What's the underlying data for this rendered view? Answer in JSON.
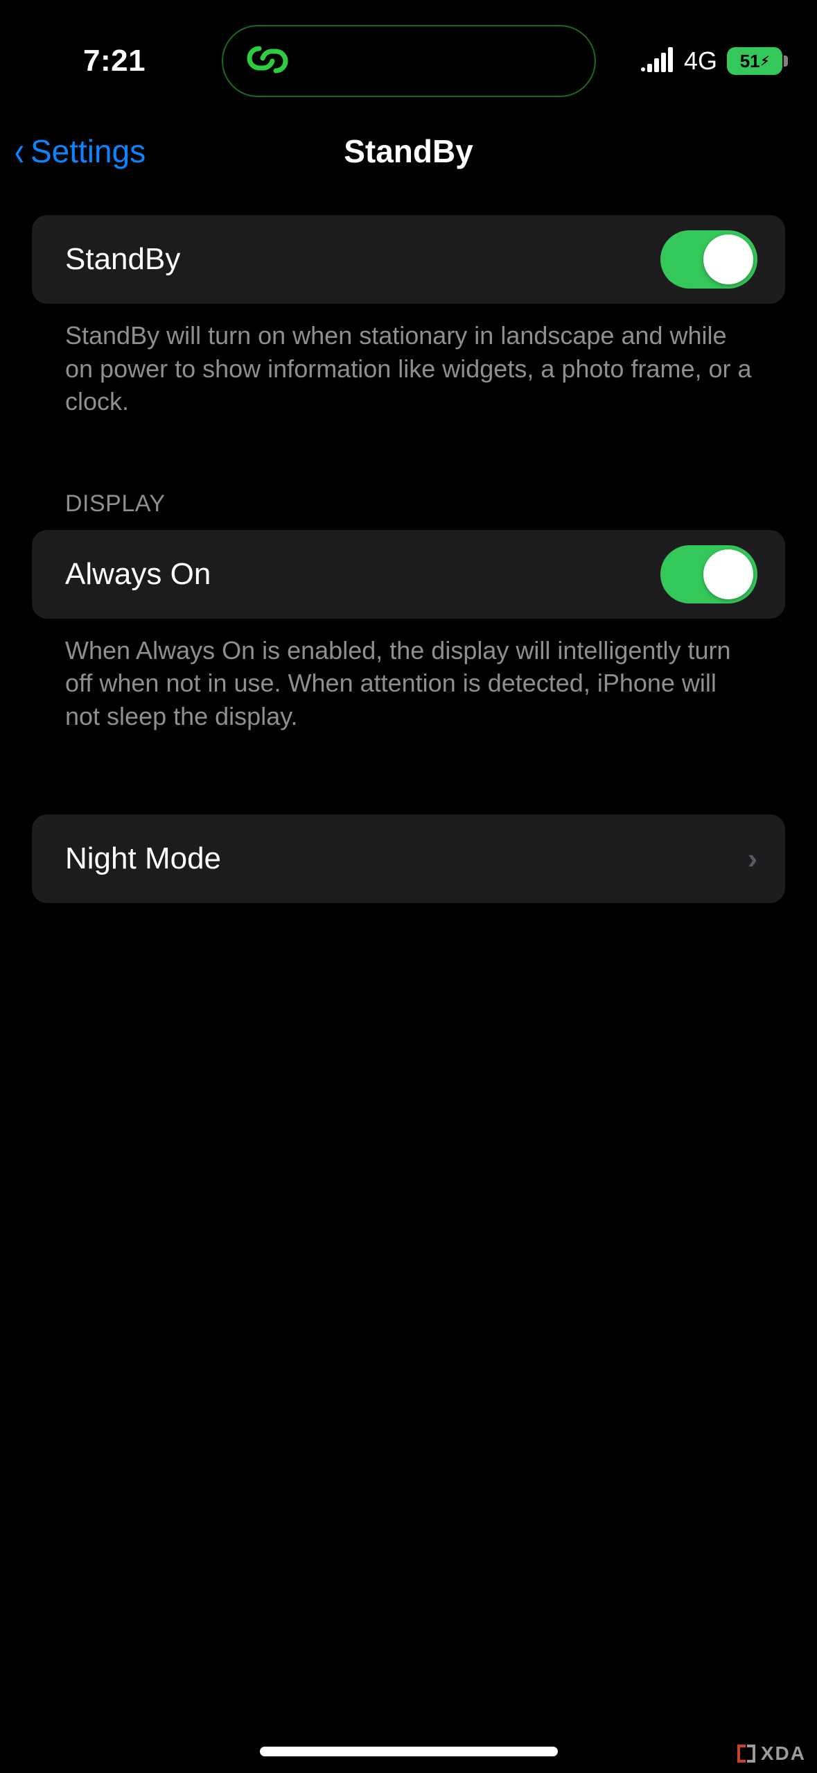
{
  "status": {
    "time": "7:21",
    "network_type": "4G",
    "battery_percent": "51"
  },
  "nav": {
    "back_label": "Settings",
    "title": "StandBy"
  },
  "sections": {
    "standby": {
      "label": "StandBy",
      "switch_on": true,
      "footer": "StandBy will turn on when stationary in landscape and while on power to show information like widgets, a photo frame, or a clock."
    },
    "display": {
      "header": "DISPLAY",
      "always_on": {
        "label": "Always On",
        "switch_on": true,
        "footer": "When Always On is enabled, the display will intelligently turn off when not in use. When attention is detected, iPhone will not sleep the display."
      }
    },
    "night_mode": {
      "label": "Night Mode"
    }
  },
  "watermark": {
    "text": "XDA"
  },
  "colors": {
    "accent_green": "#34c759",
    "link_blue": "#0a84ff",
    "cell_bg": "#1c1c1e",
    "secondary_text": "#8e8e93"
  }
}
